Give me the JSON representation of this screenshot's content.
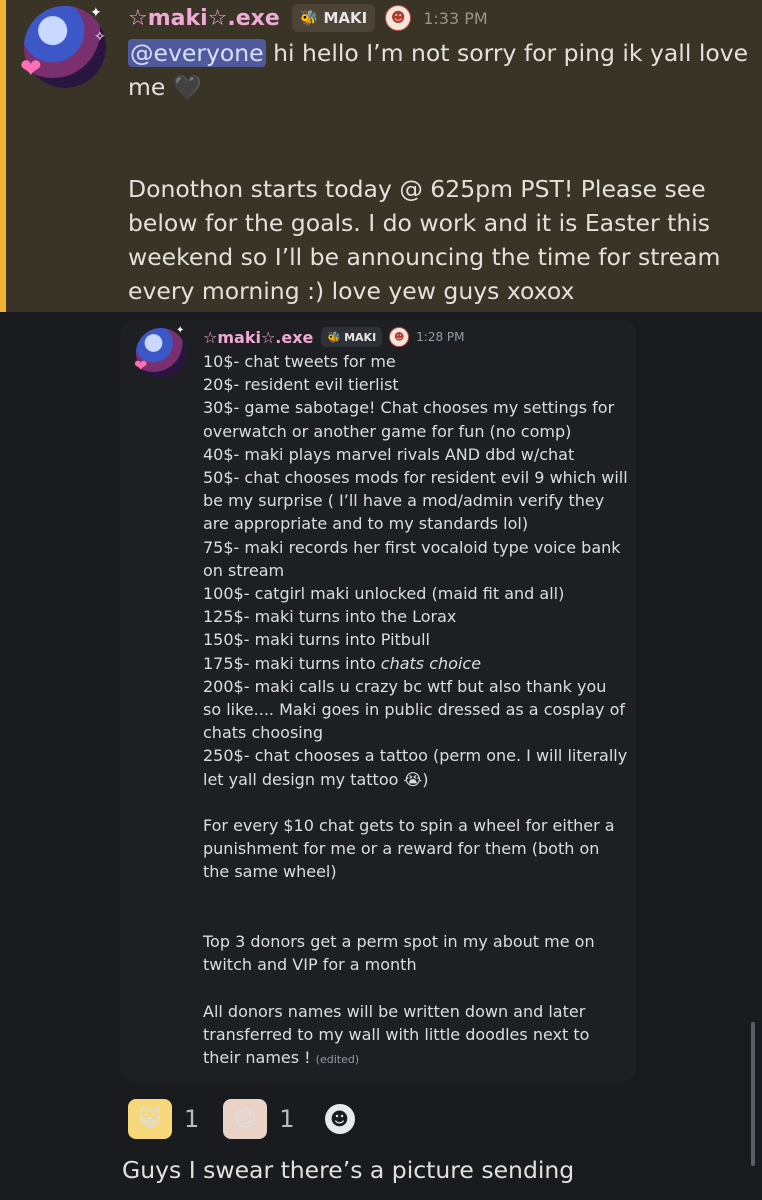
{
  "main_message": {
    "username": "☆maki☆.exe",
    "badge_label": "MAKI",
    "timestamp": "1:33 PM",
    "mention": "@everyone",
    "line1_rest": " hi hello I’m not sorry for ping ik yall love me 🖤",
    "paragraph2": "Donothon starts today @ 625pm PST! Please see below for the goals. I do work and it is Easter this weekend so I’ll be announcing the time for stream every morning :) love yew guys xoxox"
  },
  "embedded_screenshot": {
    "username": "☆maki☆.exe",
    "badge_label": "MAKI",
    "timestamp": "1:28 PM",
    "goals": [
      "10$-  chat tweets for me",
      "20$- resident evil tierlist",
      "30$- game sabotage! Chat chooses my settings for overwatch or another game for fun (no comp)",
      "40$- maki plays marvel rivals AND dbd w/chat",
      "50$- chat chooses mods for resident evil 9 which will be my surprise ( I’ll have a mod/admin verify they are appropriate and to my standards lol)",
      "75$- maki records her first vocaloid type voice bank on stream",
      "100$- catgirl maki unlocked (maid fit and all)",
      "125$- maki turns into the Lorax",
      "150$- maki turns into Pitbull",
      "200$- maki calls u crazy bc wtf but also thank you so like.... Maki goes in public dressed as a cosplay of chats choosing",
      "250$- chat chooses a tattoo (perm one. I will literally let yall design my tattoo 😭)"
    ],
    "goal_175_prefix": "175$- maki turns into ",
    "goal_175_italic": "chats choice",
    "wheel_text": "For every $10 chat gets to spin a wheel for either a punishment for me or a reward for them (both on the same wheel)",
    "top_donors_text": "Top 3 donors get a perm spot in my about me on twitch and VIP for a month",
    "donors_names_text": "All donors names will be written down and later transferred to my wall with little doodles next to their names !",
    "edited_label": "(edited)"
  },
  "reactions": [
    {
      "icon": "blonde-girl-emoji-icon",
      "count": "1"
    },
    {
      "icon": "brown-hair-girl-emoji-icon",
      "count": "1"
    }
  ],
  "add_reaction_icon": "smiley-add-reaction-icon",
  "next_message": "Guys I swear there’s a picture sending",
  "colors": {
    "highlight_bg": "#3a3427",
    "highlight_bar": "#f0b232",
    "username": "#f1a9d6",
    "mention_bg": "#4e5a9c",
    "page_bg": "#1a1b1e",
    "card_bg": "#1e1f22"
  }
}
